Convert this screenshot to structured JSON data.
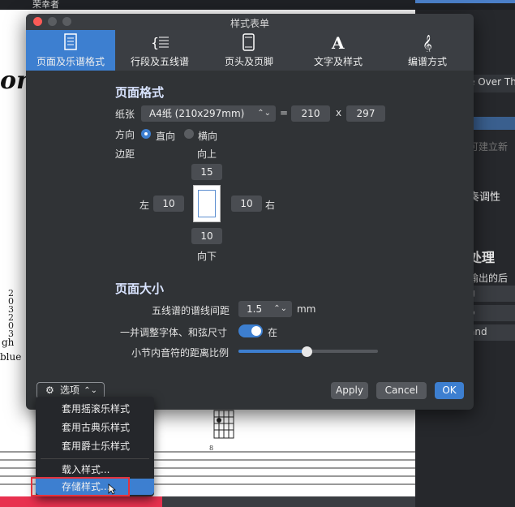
{
  "background": {
    "top_title": "荣幸者",
    "score_text_big": "om",
    "lyric_line1": "gh",
    "lyric_line2": "blue",
    "tab_numbers": "2\n0\n3\n2\n0\n3",
    "measure_number": "8",
    "right_panel": {
      "row1": "e Over The",
      "row3": "可建立新",
      "row4": "奏调性",
      "row6": "处理",
      "row7": "输出的后",
      "row8": "g",
      "row9": "o",
      "row10": "and"
    }
  },
  "dialog": {
    "title": "样式表单",
    "tabs": [
      {
        "label": "页面及乐谱格式",
        "icon": "document-icon",
        "active": true
      },
      {
        "label": "行段及五线谱",
        "icon": "staff-lines-icon",
        "active": false
      },
      {
        "label": "页头及页脚",
        "icon": "phone-page-icon",
        "active": false
      },
      {
        "label": "文字及样式",
        "icon": "text-style-icon",
        "active": false
      },
      {
        "label": "编谱方式",
        "icon": "treble-clef-icon",
        "active": false
      }
    ],
    "page_format": {
      "heading": "页面格式",
      "paper_label": "纸张",
      "paper_value": "A4纸 (210x297mm)",
      "equals": "=",
      "width": "210",
      "times": "x",
      "height": "297",
      "orientation_label": "方向",
      "portrait_label": "直向",
      "landscape_label": "横向",
      "margins_label": "边距",
      "top_label": "向上",
      "top_value": "15",
      "left_label": "左",
      "left_value": "10",
      "right_value": "10",
      "right_label": "右",
      "bottom_value": "10",
      "bottom_label": "向下"
    },
    "page_size": {
      "heading": "页面大小",
      "staff_spacing_label": "五线谱的谱线间距",
      "staff_spacing_value": "1.5",
      "staff_spacing_unit": "mm",
      "scale_fonts_label": "一并调整字体、和弦尺寸",
      "scale_fonts_state": "在",
      "scale_fonts_on": true,
      "note_distance_label": "小节内音符的距离比例",
      "note_distance_level": 0.49
    },
    "options_button": "选项",
    "apply": "Apply",
    "cancel": "Cancel",
    "ok": "OK"
  },
  "options_menu": {
    "items": [
      "套用摇滚乐样式",
      "套用古典乐样式",
      "套用爵士乐样式",
      "载入样式...",
      "存储样式..."
    ],
    "highlighted_index": 4
  },
  "colors": {
    "accent": "#3d7fd0",
    "dialog_bg": "#303336",
    "highlight_border": "#e4333d"
  }
}
